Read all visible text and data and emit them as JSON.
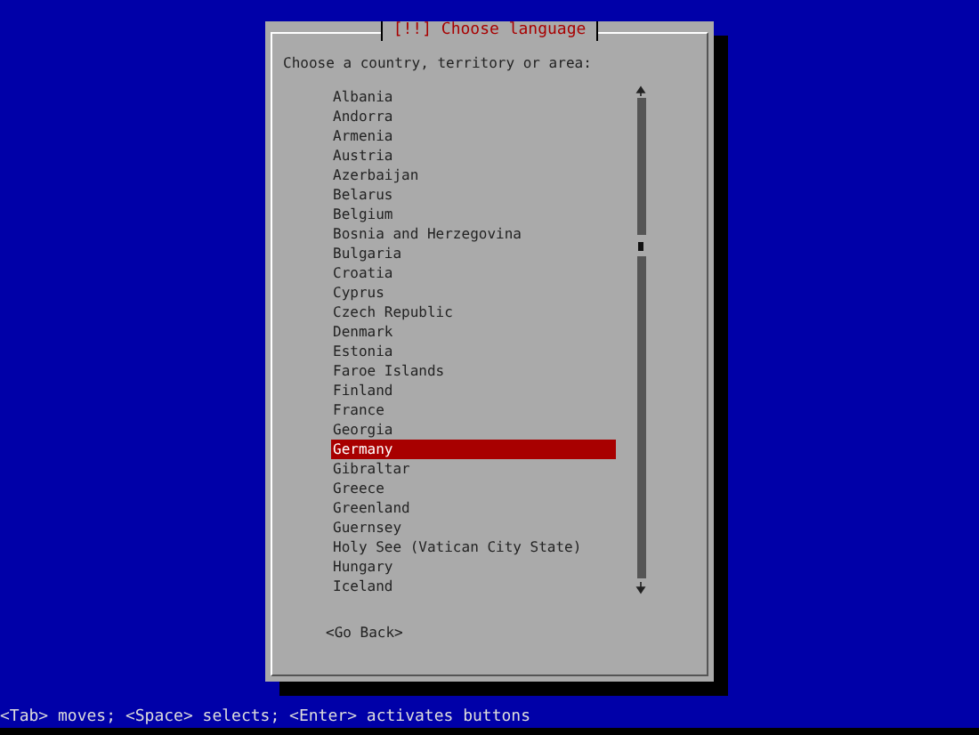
{
  "dialog": {
    "title": "[!!] Choose language",
    "prompt": "Choose a country, territory or area:",
    "items": [
      {
        "label": "Albania",
        "selected": false
      },
      {
        "label": "Andorra",
        "selected": false
      },
      {
        "label": "Armenia",
        "selected": false
      },
      {
        "label": "Austria",
        "selected": false
      },
      {
        "label": "Azerbaijan",
        "selected": false
      },
      {
        "label": "Belarus",
        "selected": false
      },
      {
        "label": "Belgium",
        "selected": false
      },
      {
        "label": "Bosnia and Herzegovina",
        "selected": false
      },
      {
        "label": "Bulgaria",
        "selected": false
      },
      {
        "label": "Croatia",
        "selected": false
      },
      {
        "label": "Cyprus",
        "selected": false
      },
      {
        "label": "Czech Republic",
        "selected": false
      },
      {
        "label": "Denmark",
        "selected": false
      },
      {
        "label": "Estonia",
        "selected": false
      },
      {
        "label": "Faroe Islands",
        "selected": false
      },
      {
        "label": "Finland",
        "selected": false
      },
      {
        "label": "France",
        "selected": false
      },
      {
        "label": "Georgia",
        "selected": false
      },
      {
        "label": "Germany",
        "selected": true
      },
      {
        "label": "Gibraltar",
        "selected": false
      },
      {
        "label": "Greece",
        "selected": false
      },
      {
        "label": "Greenland",
        "selected": false
      },
      {
        "label": "Guernsey",
        "selected": false
      },
      {
        "label": "Holy See (Vatican City State)",
        "selected": false
      },
      {
        "label": "Hungary",
        "selected": false
      },
      {
        "label": "Iceland",
        "selected": false
      }
    ],
    "button": "<Go Back>"
  },
  "status_bar": "<Tab> moves; <Space> selects; <Enter> activates buttons"
}
